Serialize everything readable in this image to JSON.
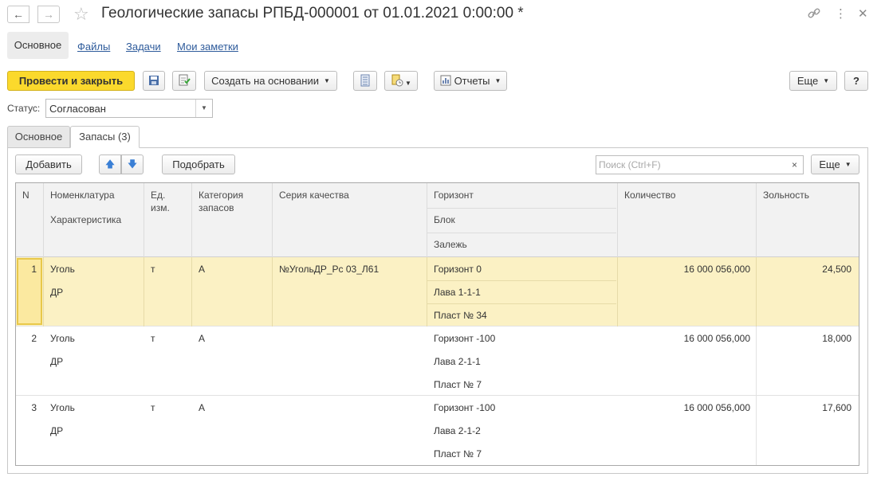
{
  "window": {
    "title": "Геологические запасы РПБД-000001 от 01.01.2021 0:00:00 *"
  },
  "nav": {
    "back_icon": "arrow-left",
    "forward_icon": "arrow-right",
    "favorite_icon": "star-outline",
    "link_icon": "link",
    "more_icon": "vertical-dots",
    "close_icon": "close"
  },
  "links": {
    "main": "Основное",
    "files": "Файлы",
    "tasks": "Задачи",
    "notes": "Мои заметки"
  },
  "toolbar": {
    "post_close": "Провести и закрыть",
    "create_based": "Создать на основании",
    "reports": "Отчеты",
    "more": "Еще",
    "help": "?"
  },
  "status": {
    "label": "Статус:",
    "value": "Согласован"
  },
  "tabs": {
    "main": "Основное",
    "reserves": "Запасы (3)"
  },
  "table_toolbar": {
    "add": "Добавить",
    "pick": "Подобрать",
    "search_placeholder": "Поиск (Ctrl+F)",
    "clear": "×",
    "more": "Еще"
  },
  "grid": {
    "headers": {
      "n": "N",
      "nomenclature": "Номенклатура",
      "characteristic": "Характеристика",
      "unit_line1": "Ед.",
      "unit_line2": "изм.",
      "category_line1": "Категория",
      "category_line2": "запасов",
      "quality_series": "Серия качества",
      "horizon": "Горизонт",
      "block": "Блок",
      "deposit": "Залежь",
      "quantity": "Количество",
      "ash": "Зольность"
    },
    "rows": [
      {
        "n": "1",
        "nomenclature": "Уголь",
        "characteristic": "ДР",
        "unit": "т",
        "category": "А",
        "quality_series": "№УгольДР_Рс 03_Л61",
        "horizon": "Горизонт 0",
        "block": "Лава 1-1-1",
        "deposit": "Пласт № 34",
        "quantity": "16 000 056,000",
        "ash": "24,500"
      },
      {
        "n": "2",
        "nomenclature": "Уголь",
        "characteristic": "ДР",
        "unit": "т",
        "category": "А",
        "quality_series": "",
        "horizon": "Горизонт -100",
        "block": "Лава 2-1-1",
        "deposit": "Пласт № 7",
        "quantity": "16 000 056,000",
        "ash": "18,000"
      },
      {
        "n": "3",
        "nomenclature": "Уголь",
        "characteristic": "ДР",
        "unit": "т",
        "category": "А",
        "quality_series": "",
        "horizon": "Горизонт -100",
        "block": "Лава 2-1-2",
        "deposit": "Пласт № 7",
        "quantity": "16 000 056,000",
        "ash": "17,600"
      }
    ]
  }
}
